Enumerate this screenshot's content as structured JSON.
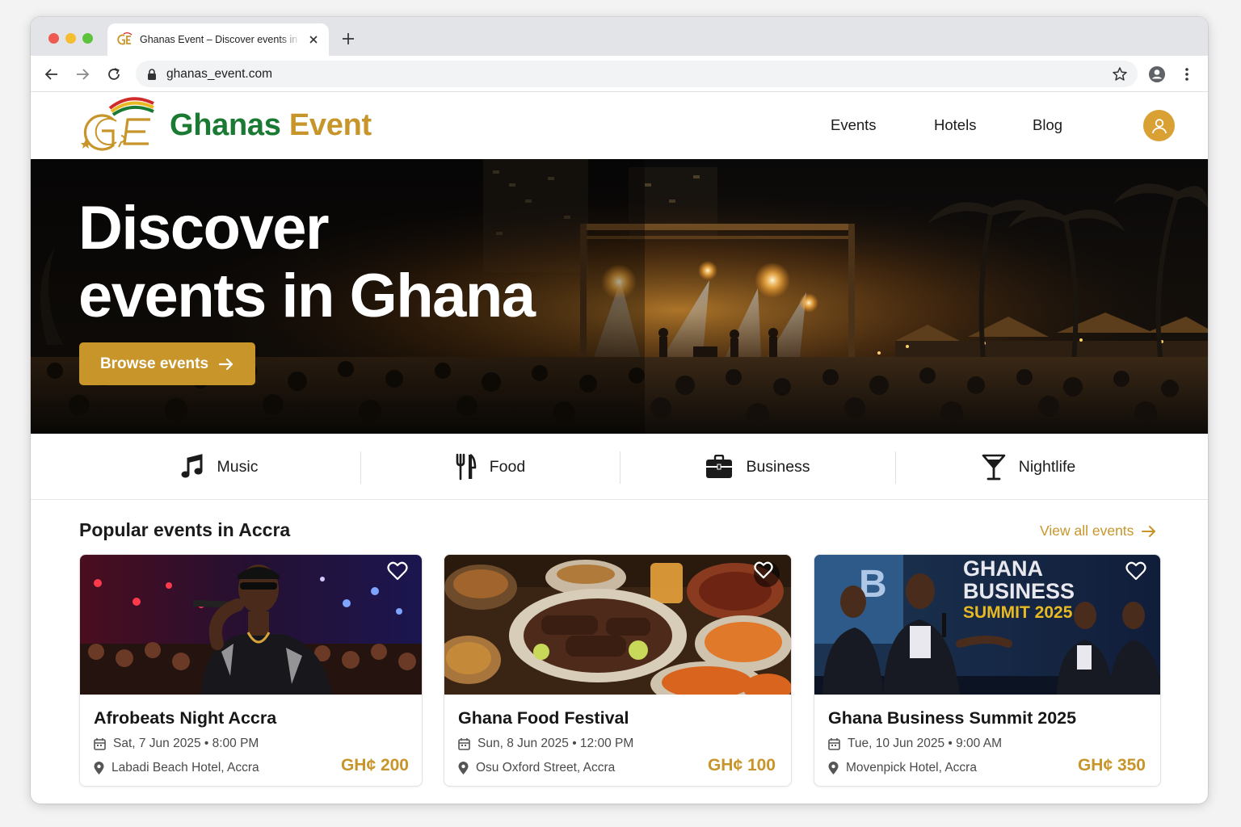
{
  "browser": {
    "tab_title": "Ghanas Event – Discover events in Ghana",
    "url": "ghanas_event.com"
  },
  "site": {
    "brand_first": "Ghanas",
    "brand_second": "Event",
    "nav": [
      "Events",
      "Hotels",
      "Blog"
    ]
  },
  "hero": {
    "title_line1": "Discover",
    "title_line2": "events in Ghana",
    "button_label": "Browse events"
  },
  "categories": [
    {
      "label": "Music",
      "icon": "music-note-icon"
    },
    {
      "label": "Food",
      "icon": "fork-knife-icon"
    },
    {
      "label": "Business",
      "icon": "briefcase-icon"
    },
    {
      "label": "Nightlife",
      "icon": "cocktail-glass-icon"
    }
  ],
  "popular": {
    "title": "Popular events in Accra",
    "view_all": "View all events",
    "events": [
      {
        "title": "Afrobeats Night Accra",
        "date": "Sat, 7 Jun 2025 • 8:00 PM",
        "location": "Labadi Beach Hotel, Accra",
        "price": "GH¢ 200"
      },
      {
        "title": "Ghana Food Festival",
        "date": "Sun, 8 Jun 2025 • 12:00 PM",
        "location": "Osu Oxford Street, Accra",
        "price": "GH¢ 100"
      },
      {
        "title": "Ghana Business Summit 2025",
        "date": "Tue, 10 Jun 2025 • 9:00 AM",
        "location": "Movenpick Hotel, Accra",
        "price": "GH¢ 350",
        "banner_line1": "GHANA",
        "banner_line2": "BUSINESS",
        "banner_line3": "SUMMIT 2025"
      }
    ]
  },
  "colors": {
    "brand_green": "#1a7a33",
    "brand_gold": "#c8952a",
    "accent_avatar": "#d9a033"
  }
}
